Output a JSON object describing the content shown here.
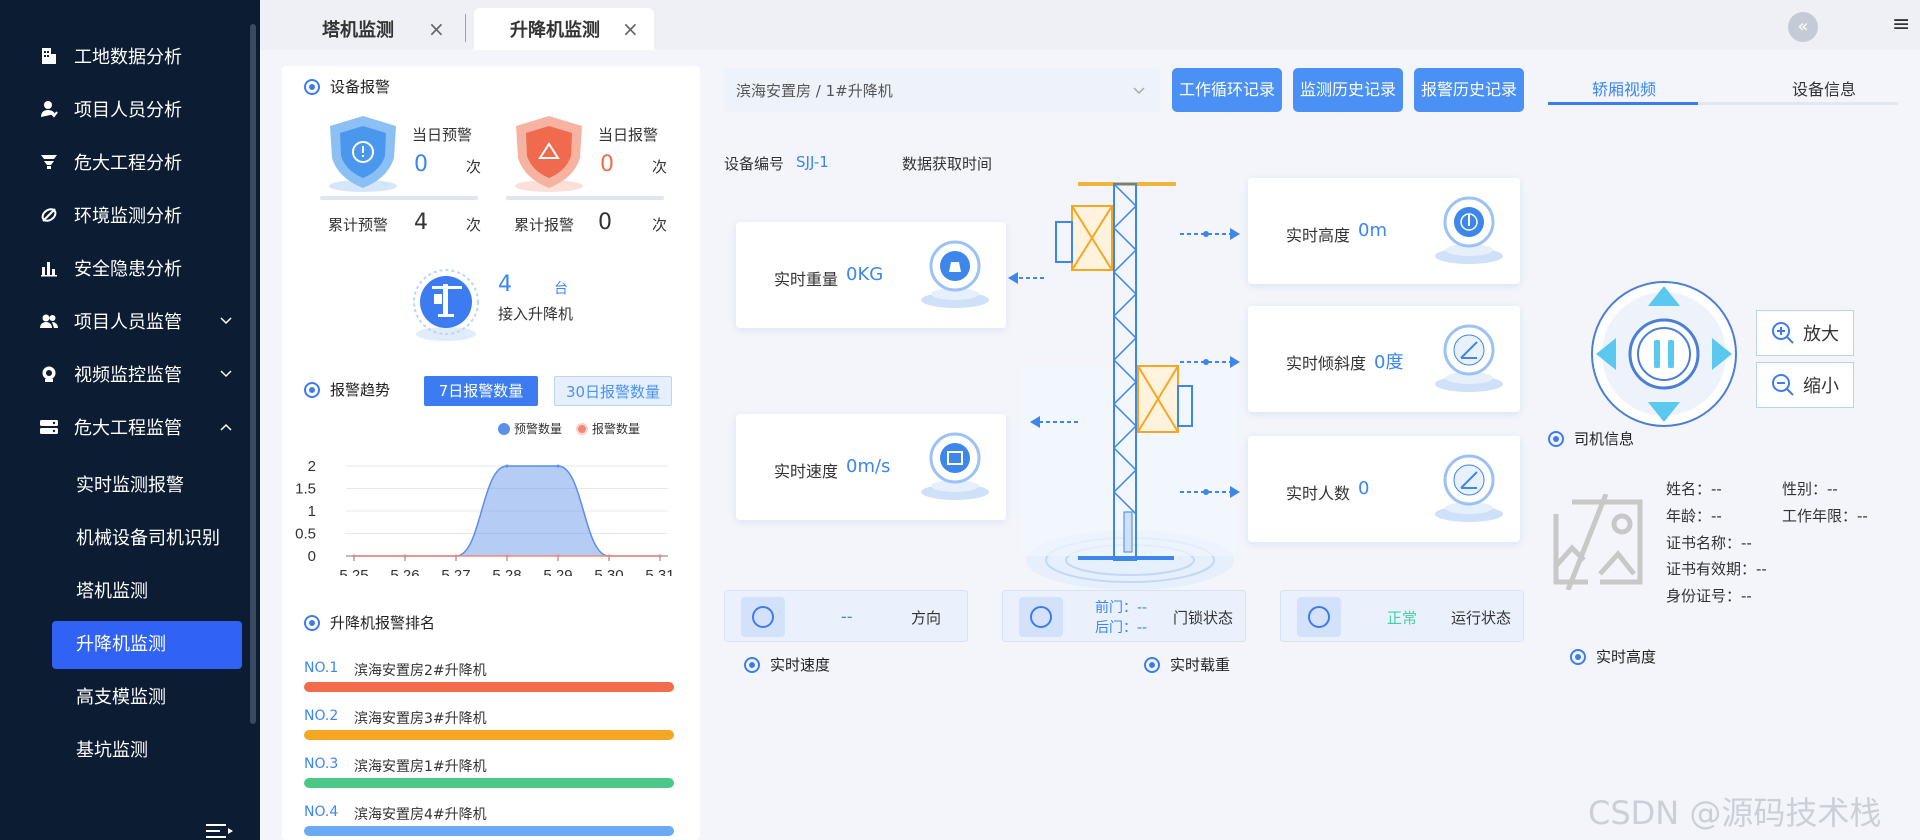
{
  "sidebar": {
    "items": [
      {
        "label": "工地数据分析",
        "icon": "building-icon"
      },
      {
        "label": "项目人员分析",
        "icon": "user-icon"
      },
      {
        "label": "危大工程分析",
        "icon": "funnel-icon"
      },
      {
        "label": "环境监测分析",
        "icon": "leaf-icon"
      },
      {
        "label": "安全隐患分析",
        "icon": "bar-chart-icon"
      },
      {
        "label": "项目人员监管",
        "icon": "users-icon"
      },
      {
        "label": "视频监控监管",
        "icon": "camera-icon"
      },
      {
        "label": "危大工程监管",
        "icon": "server-icon"
      }
    ],
    "sub_items": [
      "实时监测报警",
      "机械设备司机识别",
      "塔机监测",
      "升降机监测",
      "高支模监测",
      "基坑监测"
    ],
    "active_sub": "升降机监测"
  },
  "tabs": [
    {
      "label": "塔机监测",
      "close": "×"
    },
    {
      "label": "升降机监测",
      "close": "×"
    }
  ],
  "topbar": {
    "back": "«",
    "menu": "≡"
  },
  "alarm": {
    "title": "设备报警",
    "today_warning_label": "当日预警",
    "today_warning_value": "0",
    "unit": "次",
    "today_alarm_label": "当日报警",
    "today_alarm_value": "0",
    "total_warning_label": "累计预警",
    "total_warning_value": "4",
    "total_alarm_label": "累计报警",
    "total_alarm_value": "0",
    "connected_value": "4",
    "connected_unit": "台",
    "connected_label": "接入升降机"
  },
  "trend": {
    "title": "报警趋势",
    "btn_7": "7日报警数量",
    "btn_30": "30日报警数量"
  },
  "chart_data": {
    "type": "area",
    "x": [
      "5.25",
      "5.26",
      "5.27",
      "5.28",
      "5.29",
      "5.30",
      "5.31"
    ],
    "series": [
      {
        "name": "预警数量",
        "values": [
          0,
          0,
          0,
          2,
          2,
          0,
          0
        ],
        "color": "#5b8fe8"
      },
      {
        "name": "报警数量",
        "values": [
          0,
          0,
          0,
          0,
          0,
          0,
          0
        ],
        "color": "#f08a78"
      }
    ],
    "yticks": [
      "2",
      "1.5",
      "1",
      "0.5",
      "0"
    ],
    "ylim": [
      0,
      2
    ],
    "legend": "top-right",
    "grid": true
  },
  "ranking": {
    "title": "升降机报警排名",
    "items": [
      {
        "rank": "NO.1",
        "name": "滨海安置房2#升降机",
        "color": "#f26b4b"
      },
      {
        "rank": "NO.2",
        "name": "滨海安置房3#升降机",
        "color": "#f5a623"
      },
      {
        "rank": "NO.3",
        "name": "滨海安置房1#升降机",
        "color": "#4cc787"
      },
      {
        "rank": "NO.4",
        "name": "滨海安置房4#升降机",
        "color": "#6aaaf5"
      }
    ]
  },
  "main": {
    "device_select": "滨海安置房 / 1#升降机",
    "buttons": [
      "工作循环记录",
      "监测历史记录",
      "报警历史记录"
    ],
    "device_no_label": "设备编号",
    "device_no_value": "SJJ-1",
    "fetch_time_label": "数据获取时间",
    "weight_label": "实时重量",
    "weight_value": "0KG",
    "speed_label": "实时速度",
    "speed_value": "0m/s",
    "height_label": "实时高度",
    "height_value": "0m",
    "tilt_label": "实时倾斜度",
    "tilt_value": "0度",
    "people_label": "实时人数",
    "people_value": "0",
    "direction_value": "--",
    "direction_label": "方向",
    "front_door": "前门：--",
    "back_door": "后门：--",
    "door_label": "门锁状态",
    "run_value": "正常",
    "run_label": "运行状态",
    "realtime_speed_title": "实时速度",
    "realtime_load_title": "实时载重"
  },
  "right": {
    "tab_video": "轿厢视频",
    "tab_info": "设备信息",
    "zoom_in": "放大",
    "zoom_out": "缩小",
    "driver_title": "司机信息",
    "name": "姓名：--",
    "gender": "性别：--",
    "age": "年龄：--",
    "work_years": "工作年限：--",
    "cert_name": "证书名称：--",
    "cert_valid": "证书有效期：--",
    "id_no": "身份证号：--",
    "height_title": "实时高度"
  },
  "watermark": "CSDN @源码技术栈"
}
